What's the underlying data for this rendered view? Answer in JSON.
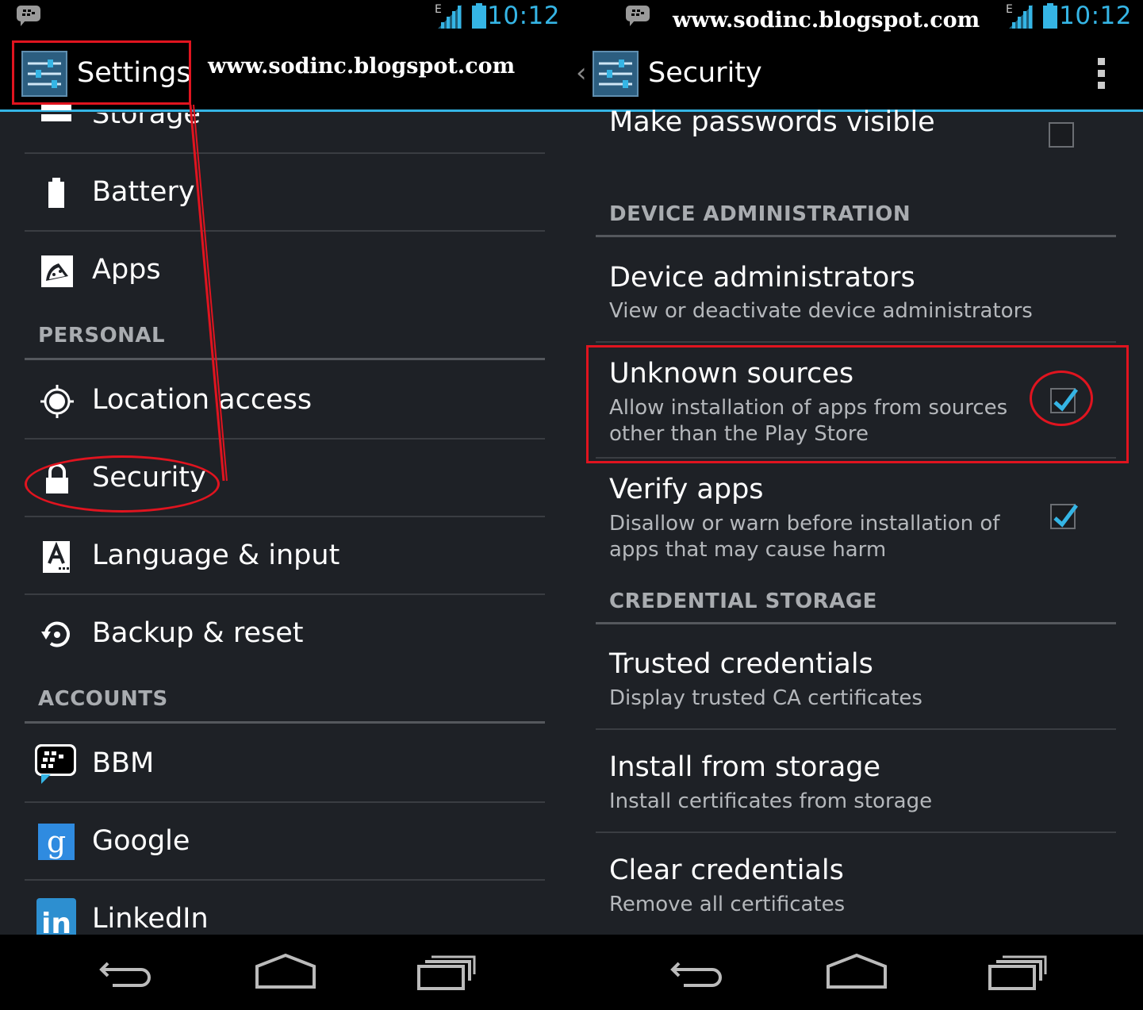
{
  "watermark_text": "www.sodinc.blogspot.com",
  "status_bar": {
    "time": "10:12",
    "network_type": "E"
  },
  "left": {
    "title": "Settings",
    "items_top": [
      {
        "label": "Storage",
        "icon": "storage-icon"
      },
      {
        "label": "Battery",
        "icon": "battery-icon"
      },
      {
        "label": "Apps",
        "icon": "apps-icon"
      }
    ],
    "section_personal": "PERSONAL",
    "items_personal": [
      {
        "label": "Location access",
        "icon": "location-icon"
      },
      {
        "label": "Security",
        "icon": "lock-icon"
      },
      {
        "label": "Language & input",
        "icon": "keyboard-icon"
      },
      {
        "label": "Backup & reset",
        "icon": "backup-icon"
      }
    ],
    "section_accounts": "ACCOUNTS",
    "items_accounts": [
      {
        "label": "BBM",
        "icon": "bbm-icon"
      },
      {
        "label": "Google",
        "icon": "google-icon"
      },
      {
        "label": "LinkedIn",
        "icon": "linkedin-icon"
      }
    ]
  },
  "right": {
    "title": "Security",
    "make_passwords_visible": {
      "title": "Make passwords visible",
      "checked": false
    },
    "section_device_admin": "DEVICE ADMINISTRATION",
    "device_administrators": {
      "title": "Device administrators",
      "summary": "View or deactivate device administrators"
    },
    "unknown_sources": {
      "title": "Unknown sources",
      "summary_line1": "Allow installation of apps from sources",
      "summary_line2": "other than the Play Store",
      "checked": true
    },
    "verify_apps": {
      "title": "Verify apps",
      "summary_line1": "Disallow or warn before installation of",
      "summary_line2": "apps that may cause harm",
      "checked": true
    },
    "section_credential": "CREDENTIAL STORAGE",
    "trusted_credentials": {
      "title": "Trusted credentials",
      "summary": "Display trusted CA certificates"
    },
    "install_from_storage": {
      "title": "Install from storage",
      "summary": "Install certificates from storage"
    },
    "clear_credentials": {
      "title": "Clear credentials",
      "summary": "Remove all certificates"
    }
  },
  "colors": {
    "accent": "#35b5e5",
    "annotation": "#e0141f",
    "background": "#1e2126"
  }
}
